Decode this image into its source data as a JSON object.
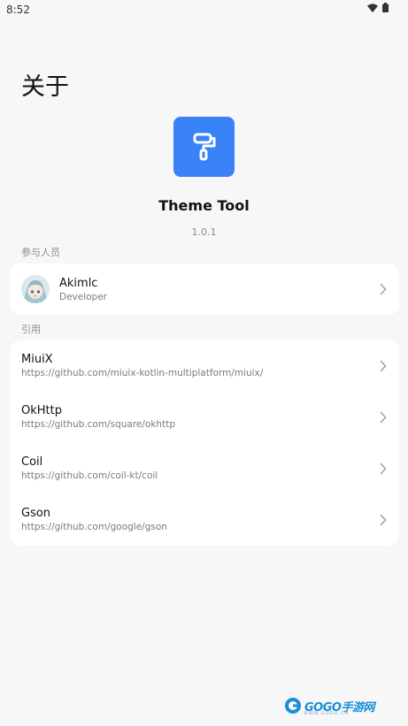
{
  "status_bar": {
    "time": "8:52"
  },
  "header": {
    "title": "关于"
  },
  "app": {
    "name": "Theme Tool",
    "version": "1.0.1",
    "icon": "paint-roller-icon",
    "accent": "#3a82f7"
  },
  "contributors": {
    "label": "参与人员",
    "items": [
      {
        "name": "Akimlc",
        "role": "Developer"
      }
    ]
  },
  "references": {
    "label": "引用",
    "items": [
      {
        "name": "MiuiX",
        "url": "https://github.com/miuix-kotlin-multiplatform/miuix/"
      },
      {
        "name": "OkHttp",
        "url": "https://github.com/square/okhttp"
      },
      {
        "name": "Coil",
        "url": "https://github.com/coil-kt/coil"
      },
      {
        "name": "Gson",
        "url": "https://github.com/google/gson"
      }
    ]
  },
  "watermark": {
    "logo": "GOGO手游网",
    "sub": "WWW.GOGO.CN"
  }
}
